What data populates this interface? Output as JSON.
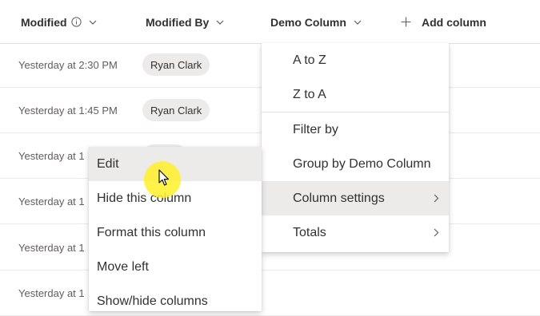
{
  "header": {
    "modified": "Modified",
    "modified_by": "Modified By",
    "demo_column": "Demo Column",
    "add_column": "Add column"
  },
  "rows": [
    {
      "modified": "Yesterday at 2:30 PM",
      "modified_by": "Ryan Clark"
    },
    {
      "modified": "Yesterday at 1:45 PM",
      "modified_by": "Ryan Clark"
    },
    {
      "modified": "Yesterday at 1"
    },
    {
      "modified": "Yesterday at 1"
    },
    {
      "modified": "Yesterday at 1"
    },
    {
      "modified": "Yesterday at 1"
    }
  ],
  "column_menu": {
    "items": [
      "A to Z",
      "Z to A",
      "Filter by",
      "Group by Demo Column",
      "Column settings",
      "Totals"
    ],
    "highlighted": "Column settings"
  },
  "settings_submenu": {
    "items": [
      "Edit",
      "Hide this column",
      "Format this column",
      "Move left",
      "Show/hide columns"
    ],
    "highlighted": "Edit"
  },
  "colors": {
    "highlight": "#edebe9",
    "cursor_halo": "#fff028",
    "pill_bg": "#edebe9"
  },
  "icons": {
    "info": "info-icon",
    "chevron": "chevron-down-icon",
    "plus": "plus-icon",
    "submenu": "chevron-right-icon"
  }
}
